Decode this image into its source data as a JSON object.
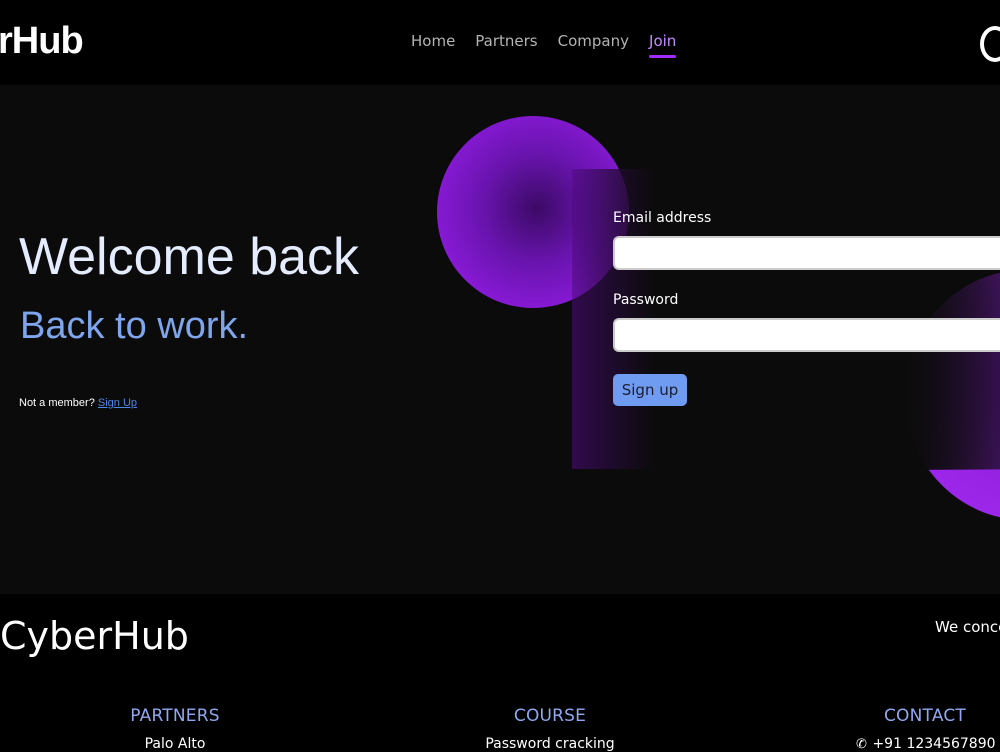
{
  "nav": {
    "brand": "rHub",
    "links": [
      {
        "label": "Home"
      },
      {
        "label": "Partners"
      },
      {
        "label": "Company"
      },
      {
        "label": "Join"
      }
    ],
    "active_link": "Join"
  },
  "hero": {
    "heading": "Welcome back",
    "tagline": "Back to work.",
    "member_text": "Not a member? ",
    "signup_link": "Sign Up"
  },
  "form": {
    "email_label": "Email address",
    "email_value": "",
    "password_label": "Password",
    "password_value": "",
    "submit_label": "Sign up"
  },
  "footer": {
    "brand": "CyberHub",
    "tagline": "We conce",
    "columns": [
      {
        "title": "PARTNERS",
        "item": "Palo Alto"
      },
      {
        "title": "COURSE",
        "item": "Password cracking"
      },
      {
        "title": "CONTACT",
        "item": "+91 1234567890"
      }
    ]
  },
  "colors": {
    "accent": "#a02cff",
    "link": "#4f86e8",
    "heading_blue": "#7fa6ec",
    "button": "#6f9cf0",
    "footer_heading": "#8fa8f0"
  },
  "icons": {
    "phone": "phone-icon",
    "nav_edge": "partial-logo-icon"
  }
}
